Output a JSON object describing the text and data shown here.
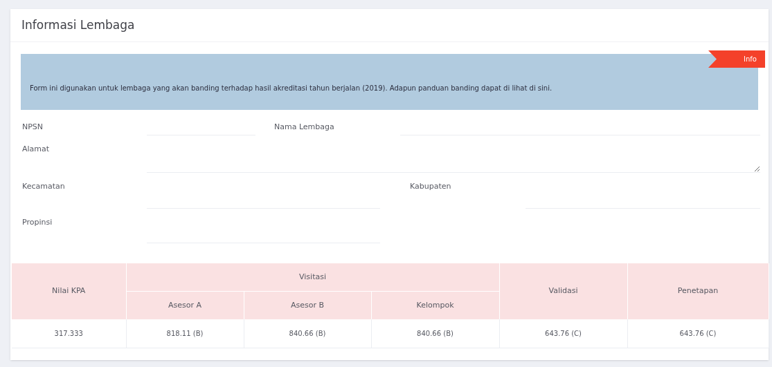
{
  "panel": {
    "title": "Informasi Lembaga"
  },
  "notice": {
    "badge": "Info",
    "text": "Form ini digunakan untuk lembaga yang akan banding terhadap hasil akreditasi tahun berjalan (2019). Adapun panduan banding dapat di lihat di sini."
  },
  "fields": {
    "npsn": {
      "label": "NPSN"
    },
    "nama_lembaga": {
      "label": "Nama Lembaga"
    },
    "alamat": {
      "label": "Alamat"
    },
    "kecamatan": {
      "label": "Kecamatan"
    },
    "kabupaten": {
      "label": "Kabupaten"
    },
    "propinsi": {
      "label": "Propinsi"
    }
  },
  "table": {
    "nilai_kpa": "Nilai KPA",
    "visitasi": "Visitasi",
    "sub_columns": [
      "Asesor A",
      "Asesor B",
      "Kelompok"
    ],
    "validasi": "Validasi",
    "penetapan": "Penetapan",
    "rows": [
      [
        "317.333",
        "818.11 (B)",
        "840.66 (B)",
        "840.66 (B)",
        "643.76 (C)",
        "643.76 (C)"
      ]
    ]
  }
}
